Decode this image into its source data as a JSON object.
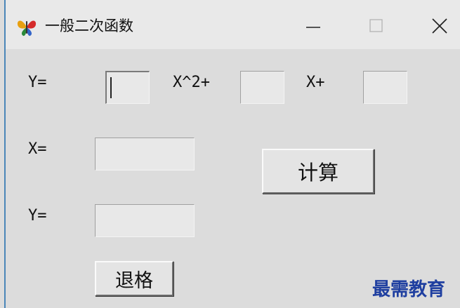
{
  "window": {
    "title": "一般二次函数",
    "icon": "butterfly-app-icon",
    "controls": {
      "minimize": "minimize-icon",
      "maximize": "maximize-icon",
      "close": "close-icon"
    }
  },
  "form": {
    "y_label": "Y=",
    "x2_label": "X^2+",
    "x_label": "X+",
    "x_input_label": "X=",
    "y_output_label": "Y=",
    "coef_a_value": "",
    "coef_b_value": "",
    "coef_c_value": "",
    "x_value": "",
    "y_value": "",
    "calculate_button": "计算",
    "backspace_button": "退格"
  },
  "watermark": "最需教育"
}
